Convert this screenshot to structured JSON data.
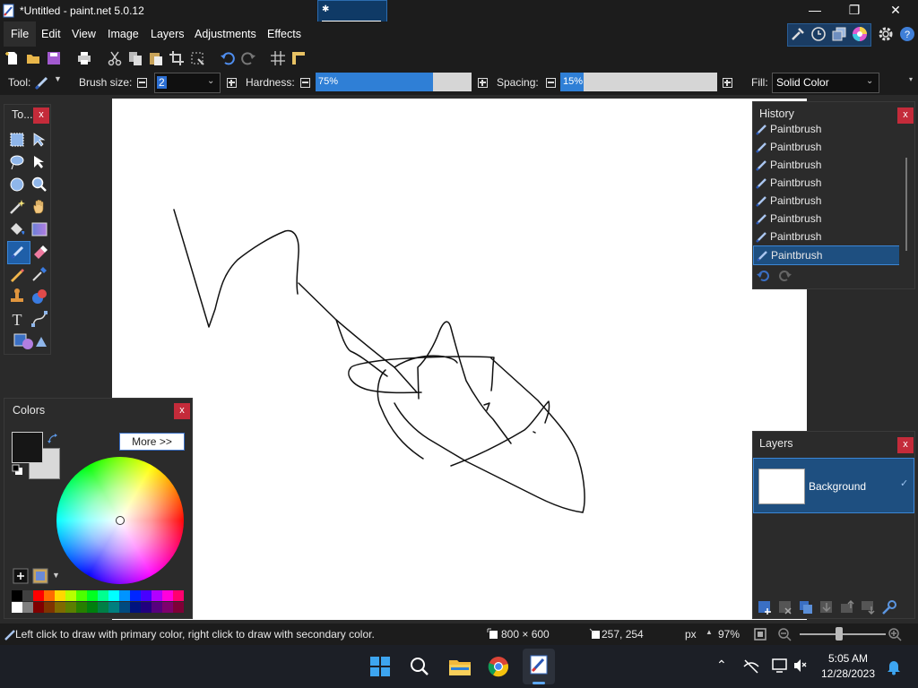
{
  "window": {
    "title": "*Untitled - paint.net 5.0.12",
    "minimize": "—",
    "maximize": "❐",
    "close": "✕"
  },
  "menu": {
    "items": [
      "File",
      "Edit",
      "View",
      "Image",
      "Layers",
      "Adjustments",
      "Effects"
    ]
  },
  "toolbar": {
    "tool_label": "Tool:",
    "brush_size_label": "Brush size:",
    "brush_size_value": "2",
    "hardness_label": "Hardness:",
    "hardness_value": "75%",
    "hardness_fraction": 0.75,
    "spacing_label": "Spacing:",
    "spacing_value": "15%",
    "spacing_fraction": 0.15,
    "fill_label": "Fill:",
    "fill_value": "Solid Color"
  },
  "tools_panel": {
    "title": "To...",
    "close": "x",
    "icons": [
      "rectangle-select-icon",
      "move-selection-icon",
      "lasso-select-icon",
      "move-selected-icon",
      "ellipse-select-icon",
      "zoom-icon",
      "magic-wand-icon",
      "pan-icon",
      "paint-bucket-icon",
      "gradient-icon",
      "paintbrush-icon",
      "eraser-icon",
      "pencil-icon",
      "color-picker-icon",
      "clone-stamp-icon",
      "recolor-icon",
      "text-icon",
      "line-curve-icon",
      "shapes-icon"
    ]
  },
  "colors_panel": {
    "title": "Colors",
    "close": "x",
    "more_label": "More >>",
    "primary_color": "#161616",
    "secondary_color": "#d9d9d9",
    "palette_top": [
      "#000000",
      "#404040",
      "#ff0000",
      "#ff6a00",
      "#ffd800",
      "#b6ff00",
      "#4cff00",
      "#00ff21",
      "#00ff90",
      "#00ffff",
      "#0094ff",
      "#0026ff",
      "#4800ff",
      "#b200ff",
      "#ff00dc",
      "#ff006e"
    ],
    "palette_bottom": [
      "#ffffff",
      "#808080",
      "#7f0000",
      "#7f3300",
      "#7f6a00",
      "#5b7f00",
      "#267f00",
      "#007f0e",
      "#007f46",
      "#007f7f",
      "#004a7f",
      "#00137f",
      "#21007f",
      "#57007f",
      "#7f006e",
      "#7f0037"
    ]
  },
  "history_panel": {
    "title": "History",
    "close": "x",
    "items": [
      "Paintbrush",
      "Paintbrush",
      "Paintbrush",
      "Paintbrush",
      "Paintbrush",
      "Paintbrush",
      "Paintbrush",
      "Paintbrush"
    ],
    "selected_index": 7
  },
  "layers_panel": {
    "title": "Layers",
    "close": "x",
    "layer_name": "Background",
    "visible": true
  },
  "statusbar": {
    "hint": "Left click to draw with primary color, right click to draw with secondary color.",
    "image_size": "800 × 600",
    "cursor_pos": "257, 254",
    "units": "px",
    "zoom": "97%"
  },
  "taskbar": {
    "time": "5:05 AM",
    "date": "12/28/2023",
    "apps": [
      "windows-start-icon",
      "search-icon",
      "file-explorer-icon",
      "chrome-icon",
      "paintnet-icon"
    ]
  },
  "colors": {
    "accent": "#0078d4",
    "close_red": "#c42b3a",
    "panel_bg": "#2b2b2b",
    "selected_row": "#1f4e79"
  }
}
